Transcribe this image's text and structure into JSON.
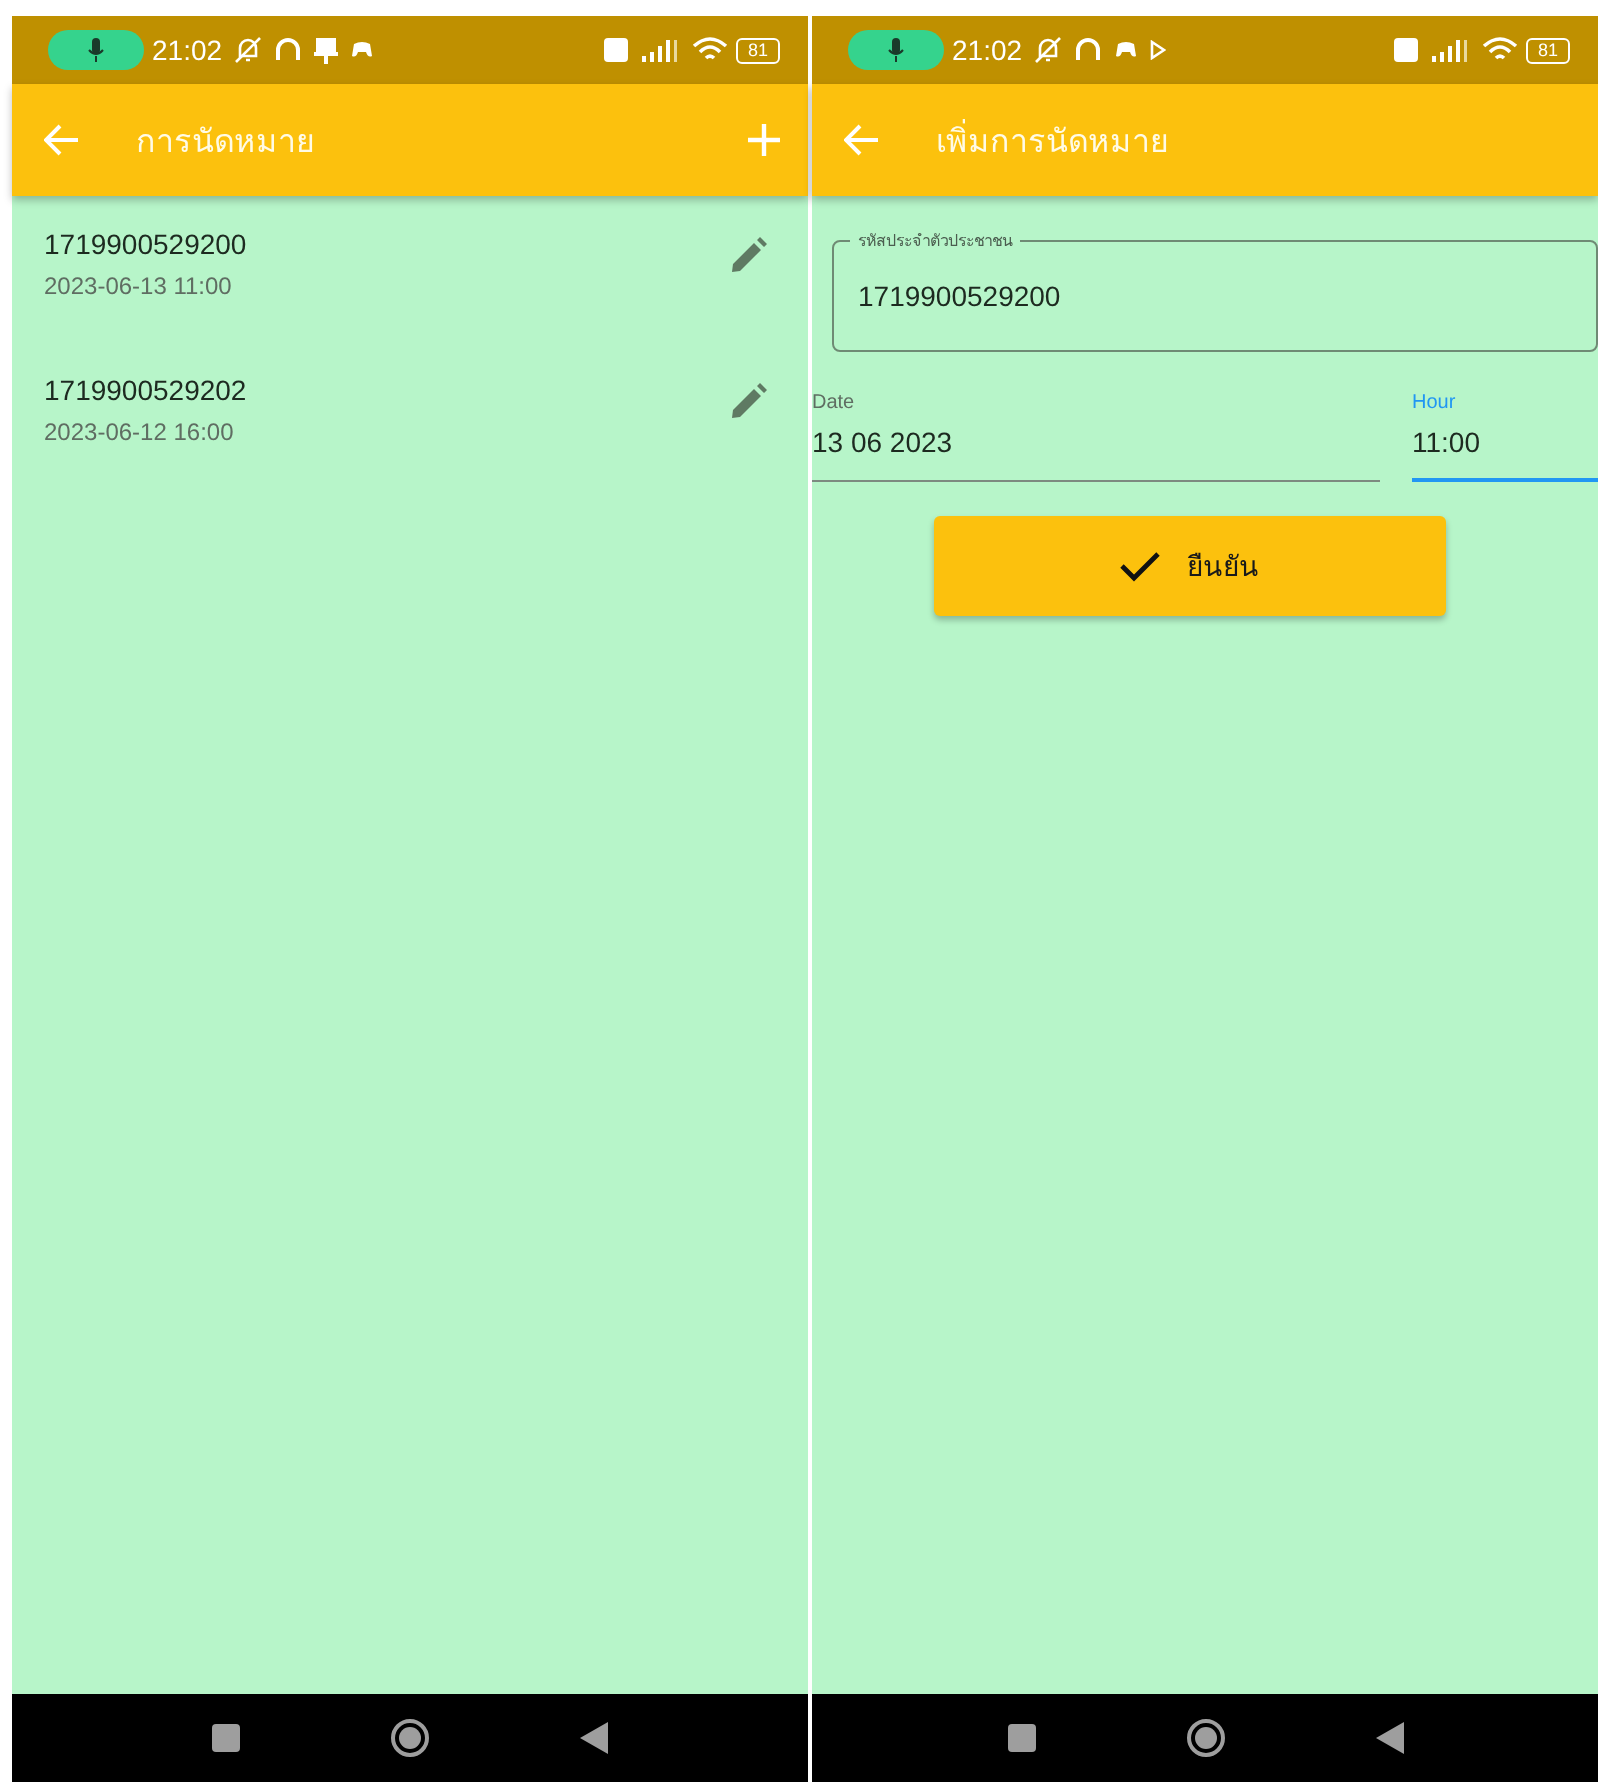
{
  "screens": [
    {
      "kind": "list",
      "status_bar": {
        "time": "21:02",
        "battery": "81"
      },
      "app_bar": {
        "title": "การนัดหมาย",
        "has_add": true
      },
      "appointments": [
        {
          "citizen_id": "1719900529200",
          "datetime": "2023-06-13 11:00"
        },
        {
          "citizen_id": "1719900529202",
          "datetime": "2023-06-12 16:00"
        }
      ]
    },
    {
      "kind": "form",
      "status_bar": {
        "time": "21:02",
        "battery": "81"
      },
      "app_bar": {
        "title": "เพิ่มการนัดหมาย",
        "has_add": false
      },
      "id_field": {
        "label": "รหัสประจำตัวประชาชน",
        "value": "1719900529200"
      },
      "date_fields": [
        {
          "label": "Date",
          "value": "13 06 2023",
          "focused": false
        },
        {
          "label": "Hour",
          "value": "11:00",
          "focused": true
        }
      ],
      "confirm_button": "ยืนยัน"
    }
  ]
}
